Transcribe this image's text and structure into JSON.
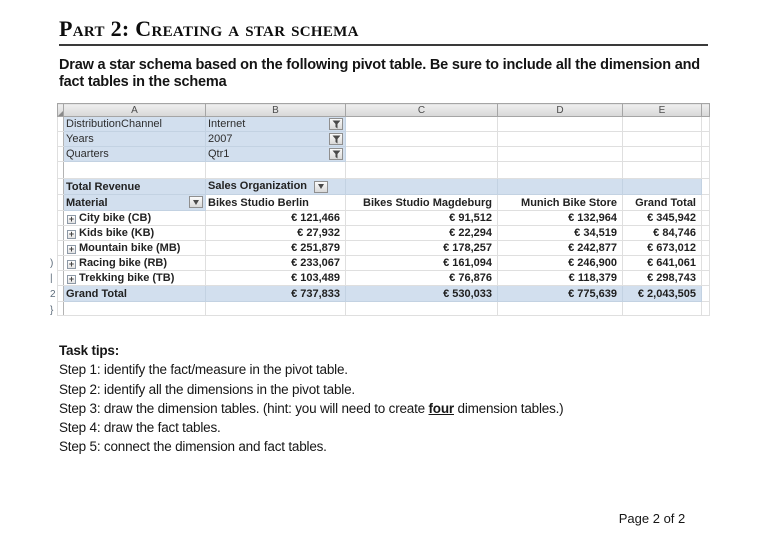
{
  "doc": {
    "title": "Part 2: Creating a star schema",
    "intro_lines": [
      "Draw a star schema based on the following pivot table. Be sure to include all the dimension and",
      "fact tables in the schema"
    ]
  },
  "sheet": {
    "column_letters": [
      "A",
      "B",
      "C",
      "D",
      "E"
    ],
    "filters": [
      {
        "field": "DistributionChannel",
        "value": "Internet"
      },
      {
        "field": "Years",
        "value": "2007"
      },
      {
        "field": "Quarters",
        "value": "Qtr1"
      }
    ],
    "measure_label": "Total Revenue",
    "column_dim_label": "Sales Organization",
    "row_dim_label": "Material",
    "col_headers": [
      "Bikes Studio Berlin",
      "Bikes Studio Magdeburg",
      "Munich Bike Store",
      "Grand Total"
    ],
    "rows": [
      {
        "label": "City bike (CB)",
        "values": [
          "€ 121,466",
          "€ 91,512",
          "€ 132,964",
          "€ 345,942"
        ]
      },
      {
        "label": "Kids bike (KB)",
        "values": [
          "€ 27,932",
          "€ 22,294",
          "€ 34,519",
          "€ 84,746"
        ]
      },
      {
        "label": "Mountain bike (MB)",
        "values": [
          "€ 251,879",
          "€ 178,257",
          "€ 242,877",
          "€ 673,012"
        ]
      },
      {
        "label": "Racing bike (RB)",
        "values": [
          "€ 233,067",
          "€ 161,094",
          "€ 246,900",
          "€ 641,061"
        ]
      },
      {
        "label": "Trekking bike (TB)",
        "values": [
          "€ 103,489",
          "€ 76,876",
          "€ 118,379",
          "€ 298,743"
        ]
      }
    ],
    "grand_total_row": {
      "label": "Grand Total",
      "values": [
        "€ 737,833",
        "€ 530,033",
        "€ 775,639",
        "€ 2,043,505"
      ]
    },
    "expand_icon": "+",
    "row_number_fragments": [
      ")",
      "|",
      "2",
      "}"
    ],
    "accent_blue": "#d2dfee"
  },
  "tips": {
    "title": "Task tips:",
    "steps": [
      {
        "prefix": "Step 1: identify the fact/measure in the pivot table."
      },
      {
        "prefix": "Step 2: identify all the dimensions in the pivot table."
      },
      {
        "prefix": "Step 3: draw the dimension tables. (hint: you will need to create ",
        "highlight": "four",
        "suffix": " dimension tables.)"
      },
      {
        "prefix": "Step 4: draw the fact tables."
      },
      {
        "prefix": "Step 5: connect the dimension and fact tables."
      }
    ]
  },
  "footer": {
    "page_label": "Page 2 of 2"
  }
}
